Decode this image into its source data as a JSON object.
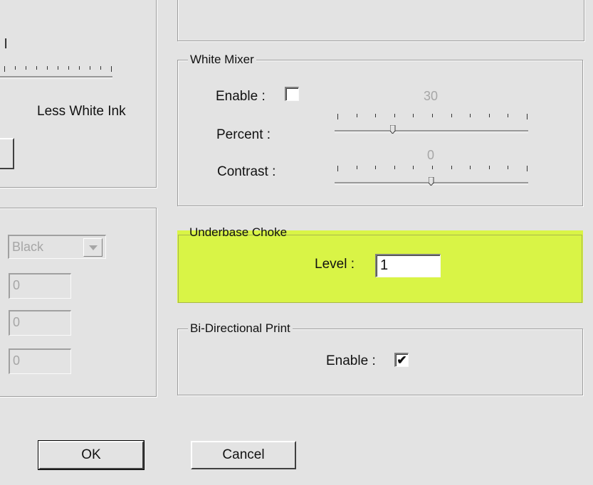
{
  "left_panel": {
    "partial_label": "l",
    "less_white_ink_label": "Less White Ink",
    "color_select_value": "Black",
    "fields": [
      "0",
      "0",
      "0"
    ]
  },
  "white_mixer": {
    "legend": "White Mixer",
    "enable_label": "Enable :",
    "enable_checked": false,
    "percent_label": "Percent :",
    "percent_value": "30",
    "percent_level": 0.3,
    "contrast_label": "Contrast :",
    "contrast_value": "0",
    "contrast_level": 0.5
  },
  "underbase_choke": {
    "legend": "Underbase Choke",
    "level_label": "Level :",
    "level_value": "1",
    "highlight_color": "#d9f446"
  },
  "bidirectional_print": {
    "legend": "Bi-Directional Print",
    "enable_label": "Enable :",
    "enable_mark": "✔"
  },
  "buttons": {
    "ok_label": "OK",
    "cancel_label": "Cancel"
  }
}
